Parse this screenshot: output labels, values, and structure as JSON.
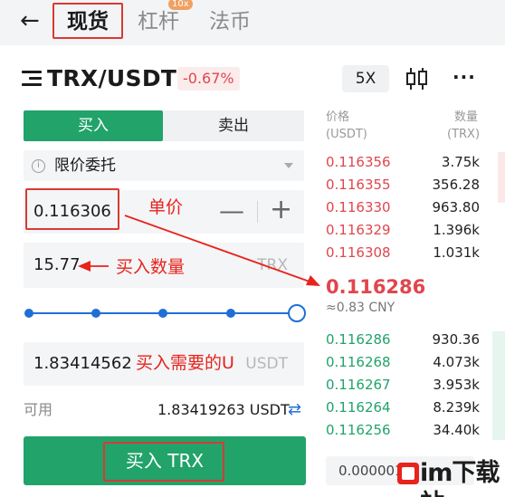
{
  "header": {
    "back": "←",
    "tabs": [
      {
        "label": "现货",
        "active": true
      },
      {
        "label": "杠杆",
        "badge": "10x"
      },
      {
        "label": "法币"
      }
    ]
  },
  "pair": {
    "symbol": "TRX/USDT",
    "change": "-0.67%",
    "leverage": "5X",
    "more": "···"
  },
  "form": {
    "buy_tab": "买入",
    "sell_tab": "卖出",
    "order_type": "限价委托",
    "price": "0.116306",
    "minus": "—",
    "plus": "+",
    "quantity": "15.77",
    "quantity_unit": "TRX",
    "slider_fraction": 1.0,
    "total": "1.83414562",
    "total_unit": "USDT",
    "available_label": "可用",
    "available_value": "1.83419263 USDT",
    "submit": "买入 TRX"
  },
  "annotations": {
    "price": "单价",
    "quantity": "买入数量",
    "total": "买入需要的U"
  },
  "orderbook": {
    "price_header": "价格",
    "price_unit": "(USDT)",
    "qty_header": "数量",
    "qty_unit": "(TRX)",
    "asks": [
      {
        "price": "0.116356",
        "qty": "3.75k"
      },
      {
        "price": "0.116355",
        "qty": "356.28"
      },
      {
        "price": "0.116330",
        "qty": "963.80"
      },
      {
        "price": "0.116329",
        "qty": "1.396k"
      },
      {
        "price": "0.116308",
        "qty": "1.031k"
      }
    ],
    "last_price": "0.116286",
    "cny": "≈0.83 CNY",
    "bids": [
      {
        "price": "0.116286",
        "qty": "930.36"
      },
      {
        "price": "0.116268",
        "qty": "4.073k"
      },
      {
        "price": "0.116267",
        "qty": "3.953k"
      },
      {
        "price": "0.116264",
        "qty": "8.239k"
      },
      {
        "price": "0.116256",
        "qty": "34.40k"
      }
    ],
    "depth": "0.000001"
  },
  "watermark": "im下载站",
  "colors": {
    "buy_green": "#21a36a",
    "sell_red": "#e0464e",
    "slider_blue": "#1f6fd6",
    "annotation_red": "#e8231b"
  }
}
